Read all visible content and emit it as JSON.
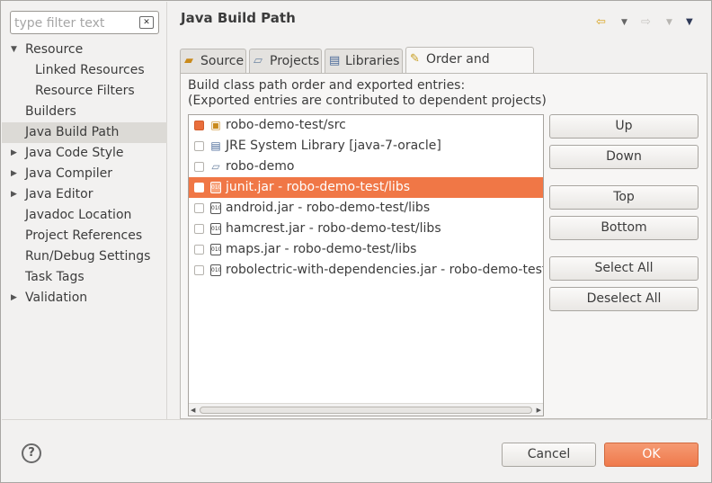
{
  "filter": {
    "placeholder": "type filter text"
  },
  "sidebar": {
    "items": [
      {
        "label": "Resource",
        "expandable": true,
        "expanded": true
      },
      {
        "label": "Linked Resources",
        "child": true
      },
      {
        "label": "Resource Filters",
        "child": true
      },
      {
        "label": "Builders"
      },
      {
        "label": "Java Build Path",
        "selected": true
      },
      {
        "label": "Java Code Style",
        "expandable": true
      },
      {
        "label": "Java Compiler",
        "expandable": true
      },
      {
        "label": "Java Editor",
        "expandable": true
      },
      {
        "label": "Javadoc Location"
      },
      {
        "label": "Project References"
      },
      {
        "label": "Run/Debug Settings"
      },
      {
        "label": "Task Tags"
      },
      {
        "label": "Validation",
        "expandable": true
      }
    ]
  },
  "header": {
    "title": "Java Build Path"
  },
  "tabs": [
    {
      "label": "Source",
      "icon": "source-folder-icon"
    },
    {
      "label": "Projects",
      "icon": "projects-icon"
    },
    {
      "label": "Libraries",
      "icon": "libraries-icon"
    },
    {
      "label": "Order and Export",
      "icon": "order-export-icon",
      "active": true
    }
  ],
  "order_export": {
    "description_line1": "Build class path order and exported entries:",
    "description_line2": "(Exported entries are contributed to dependent projects)",
    "entries": [
      {
        "label": "robo-demo-test/src",
        "icon": "package-folder-icon",
        "checked": true,
        "selected": false
      },
      {
        "label": "JRE System Library [java-7-oracle]",
        "icon": "library-icon",
        "checked": false,
        "selected": false
      },
      {
        "label": "robo-demo",
        "icon": "project-folder-icon",
        "checked": false,
        "selected": false
      },
      {
        "label": "junit.jar - robo-demo-test/libs",
        "icon": "jar-icon",
        "checked": false,
        "selected": true
      },
      {
        "label": "android.jar - robo-demo-test/libs",
        "icon": "jar-icon",
        "checked": false,
        "selected": false
      },
      {
        "label": "hamcrest.jar - robo-demo-test/libs",
        "icon": "jar-icon",
        "checked": false,
        "selected": false
      },
      {
        "label": "maps.jar - robo-demo-test/libs",
        "icon": "jar-icon",
        "checked": false,
        "selected": false
      },
      {
        "label": "robolectric-with-dependencies.jar - robo-demo-test/libs",
        "icon": "jar-icon",
        "checked": false,
        "selected": false
      }
    ],
    "buttons": {
      "up": "Up",
      "down": "Down",
      "top": "Top",
      "bottom": "Bottom",
      "select_all": "Select All",
      "deselect_all": "Deselect All"
    }
  },
  "footer": {
    "cancel": "Cancel",
    "ok": "OK"
  },
  "colors": {
    "accent": "#f07746",
    "selection": "#dcdad6"
  }
}
